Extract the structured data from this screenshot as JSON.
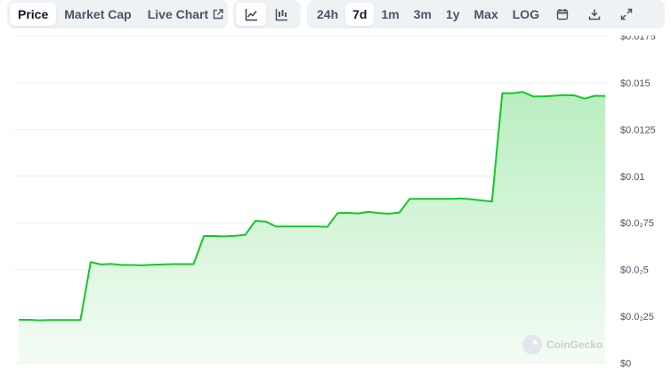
{
  "toolbar": {
    "type_tabs": [
      {
        "label": "Price",
        "active": true
      },
      {
        "label": "Market Cap",
        "active": false
      },
      {
        "label": "Live Chart",
        "active": false
      }
    ],
    "view_icons": [
      "line-chart-icon",
      "candlestick-chart-icon"
    ],
    "ranges": [
      {
        "label": "24h",
        "active": false
      },
      {
        "label": "7d",
        "active": true
      },
      {
        "label": "1m",
        "active": false
      },
      {
        "label": "3m",
        "active": false
      },
      {
        "label": "1y",
        "active": false
      },
      {
        "label": "Max",
        "active": false
      },
      {
        "label": "LOG",
        "active": false
      }
    ],
    "action_icons": [
      "calendar-icon",
      "download-icon",
      "expand-icon"
    ]
  },
  "watermark": {
    "text": "CoinGecko",
    "icon": "coingecko-logo-icon"
  },
  "colors": {
    "line": "#16c729",
    "fill_top": "#b9eec0",
    "fill_bottom": "#f4fcf5",
    "grid": "#eceef1",
    "accent_bg": "#eff2f5"
  },
  "chart_data": {
    "type": "area",
    "title": "",
    "xlabel": "",
    "ylabel": "",
    "ylim": [
      0,
      0.0175
    ],
    "yticks": [
      0,
      0.0025,
      0.005,
      0.0075,
      0.01,
      0.0125,
      0.015,
      0.0175
    ],
    "ytick_labels": [
      "$0",
      "$0.0₂25",
      "$0.0₂5",
      "$0.0₂75",
      "$0.01",
      "$0.0125",
      "$0.015",
      "$0.0175"
    ],
    "grid": true,
    "legend": "none",
    "series": [
      {
        "values": [
          0.00229,
          0.00229,
          0.00226,
          0.00228,
          0.00228,
          0.00228,
          0.00228,
          0.00538,
          0.00525,
          0.00528,
          0.00522,
          0.00522,
          0.0052,
          0.00523,
          0.00525,
          0.00527,
          0.00527,
          0.00527,
          0.00677,
          0.00677,
          0.00675,
          0.00678,
          0.00683,
          0.00758,
          0.00755,
          0.00728,
          0.00728,
          0.00728,
          0.00728,
          0.00728,
          0.00726,
          0.008,
          0.00801,
          0.00798,
          0.00807,
          0.008,
          0.00797,
          0.00803,
          0.00876,
          0.00876,
          0.00876,
          0.00876,
          0.00876,
          0.00879,
          0.00874,
          0.00868,
          0.00862,
          0.01442,
          0.01442,
          0.01448,
          0.01425,
          0.01425,
          0.01428,
          0.01432,
          0.0143,
          0.01413,
          0.01428,
          0.01427
        ]
      }
    ]
  }
}
